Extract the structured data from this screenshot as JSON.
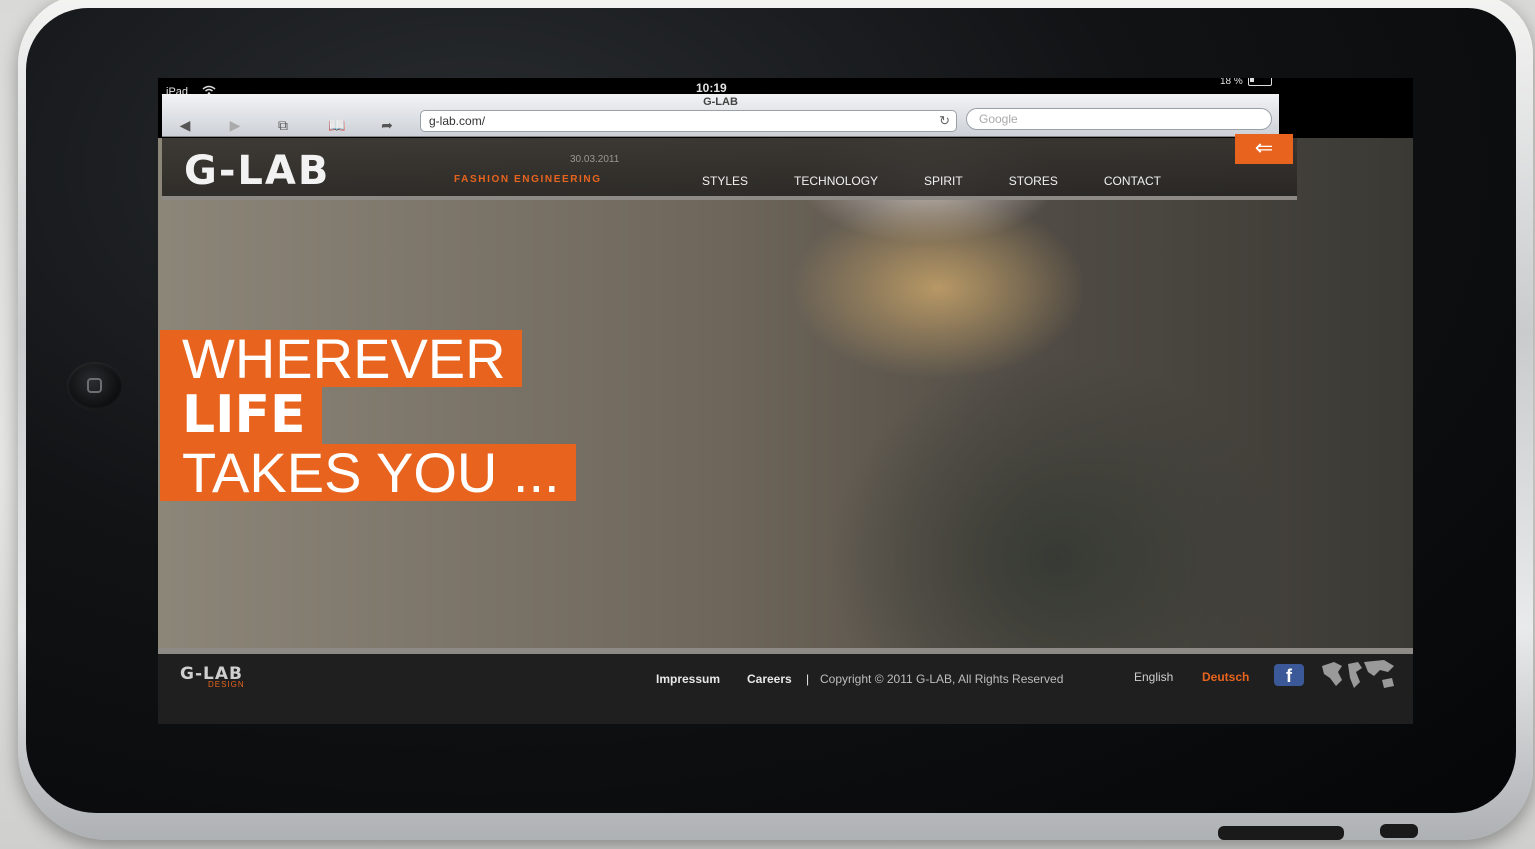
{
  "status_bar": {
    "carrier": "iPad",
    "time": "10:19",
    "battery": "18 %"
  },
  "browser": {
    "title": "G-LAB",
    "url": "g-lab.com/",
    "search_placeholder": "Google"
  },
  "site": {
    "logo": "G-LAB",
    "date": "30.03.2011",
    "tagline": "FASHION ENGINEERING",
    "nav": [
      "STYLES",
      "TECHNOLOGY",
      "SPIRIT",
      "STORES",
      "CONTACT"
    ],
    "headline": {
      "line1": "WHEREVER",
      "line2": "LIFE",
      "line3": "TAKES YOU ..."
    },
    "footer": {
      "logo": "G-LAB",
      "logo_sub": "DESIGN",
      "impressum": "Impressum",
      "careers": "Careers",
      "separator": "|",
      "copyright": "Copyright © 2011 G-LAB, All Rights Reserved",
      "lang_english": "English",
      "lang_deutsch": "Deutsch",
      "facebook": "f"
    }
  },
  "colors": {
    "accent": "#e8641e",
    "header_bg": "#373430",
    "footer_bg": "#1f1f1f"
  },
  "icons": [
    "wifi-icon",
    "battery-icon",
    "back-arrow-icon",
    "forward-arrow-icon",
    "tabs-icon",
    "bookmarks-icon",
    "share-icon",
    "reload-icon",
    "facebook-icon",
    "world-map-icon"
  ]
}
